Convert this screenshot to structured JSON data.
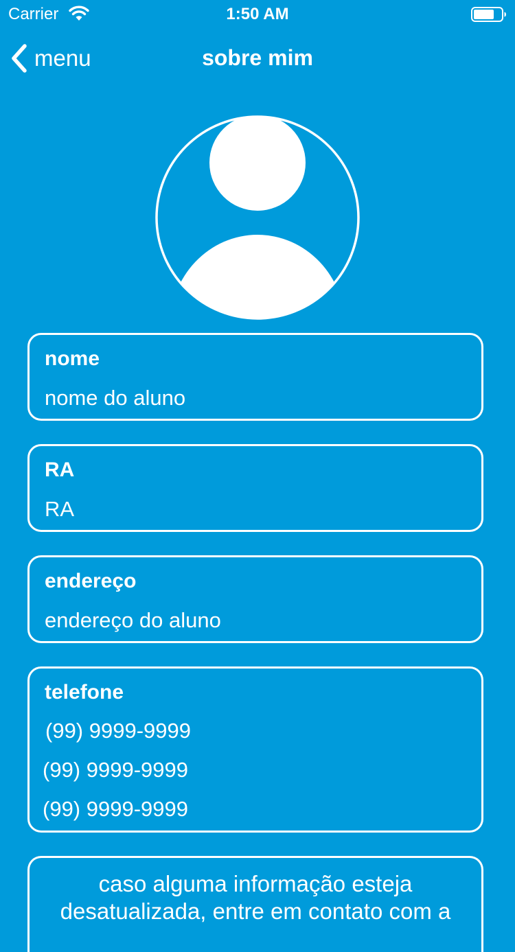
{
  "status_bar": {
    "carrier": "Carrier",
    "time": "1:50 AM",
    "wifi_icon": "wifi-icon",
    "battery_icon": "battery-icon"
  },
  "nav": {
    "back_label": "menu",
    "back_icon": "chevron-left-icon",
    "title": "sobre mim"
  },
  "profile": {
    "avatar_icon": "user-avatar-icon"
  },
  "fields": {
    "nome": {
      "label": "nome",
      "value": "nome do aluno"
    },
    "ra": {
      "label": "RA",
      "value": "RA"
    },
    "endereco": {
      "label": "endereço",
      "value": "endereço do aluno"
    },
    "telefone": {
      "label": "telefone",
      "values": [
        "(99) 9999-9999",
        "(99) 9999-9999",
        "(99) 9999-9999"
      ]
    }
  },
  "notice": {
    "line1": "caso alguma informação esteja",
    "line2": "desatualizada, entre em contato com a"
  },
  "colors": {
    "background": "#009bdb",
    "foreground": "#ffffff"
  }
}
